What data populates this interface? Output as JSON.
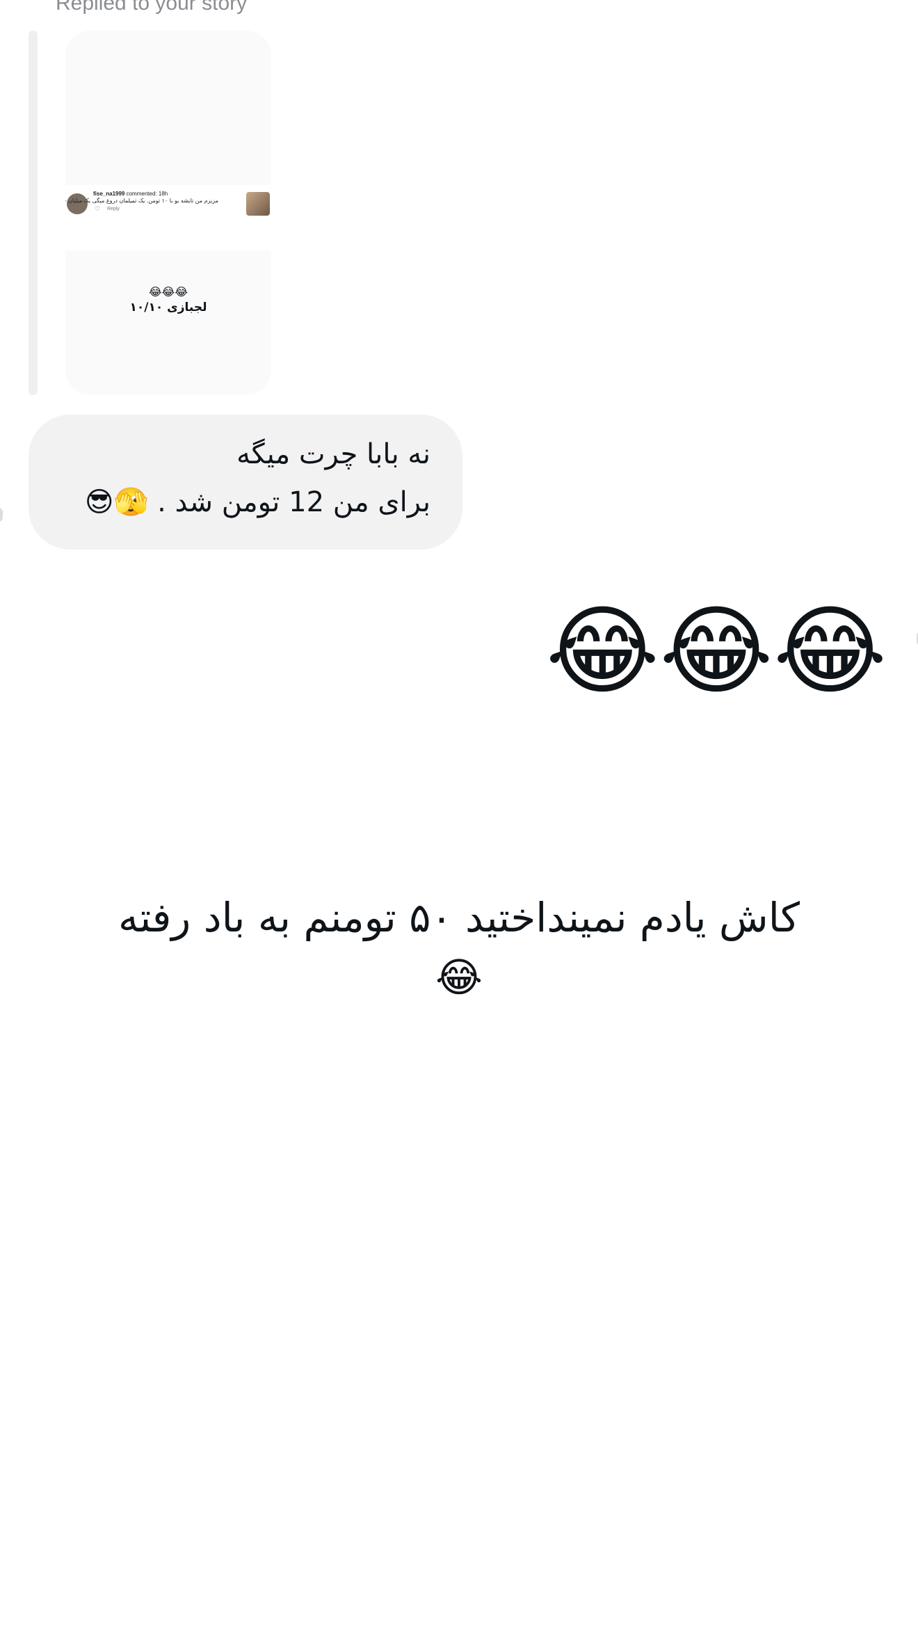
{
  "reply": {
    "header": "Replied to your story"
  },
  "story": {
    "comment_username": "fise_na1999",
    "comment_action": "commented:",
    "comment_text": "مزیزم من تابشه یو با ۱۰ تومن. یک تمیلمان دروغ میگی یک میلیان 😂😂😂😂😂😂",
    "comment_time": "18h",
    "comment_reply_label": "Reply",
    "emoji_row": "😂😂😂",
    "caption": "لجبازی ۱۰/۱۰"
  },
  "bubble": {
    "line1": "نه بابا چرت میگه",
    "line2": "برای من 12 تومن شد . 🫣😎"
  },
  "emoji_message": {
    "text": "😂😂😂"
  },
  "story_text": {
    "text": "کاش یادم نمینداختید ۵۰ تومنم به باد رفته😂"
  }
}
